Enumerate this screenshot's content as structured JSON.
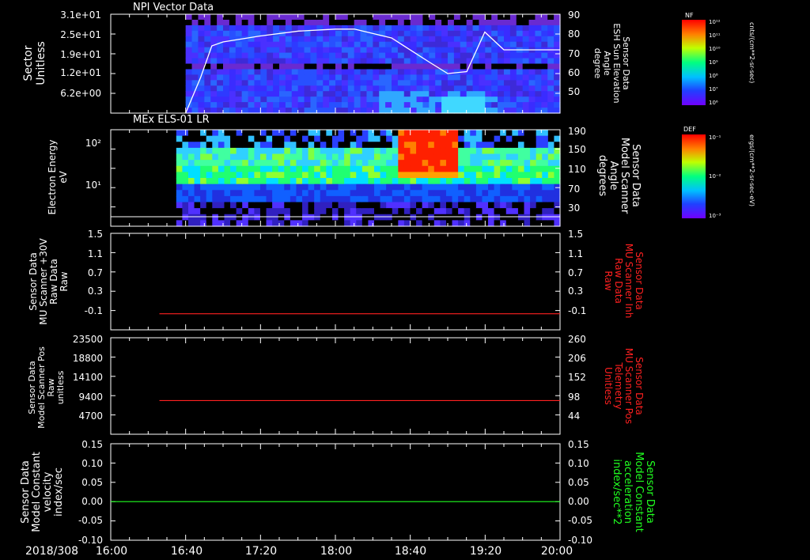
{
  "colors": {
    "background": "#000000",
    "axis": "#ffffff",
    "red_trace": "#ff2020",
    "green_trace": "#20ff20",
    "white_trace": "#ffffff"
  },
  "time_axis": {
    "start_label": "2018/308",
    "ticks": [
      "16:00",
      "16:40",
      "17:20",
      "18:00",
      "18:40",
      "19:20",
      "20:00"
    ],
    "start_hour": 16.0,
    "end_hour": 20.0,
    "data_start_hour": 16.6667
  },
  "chart_data": [
    {
      "type": "heatmap",
      "title": "NPI Vector Data",
      "ylabel_left": [
        "Sector",
        "Unitless"
      ],
      "yticks_left": [
        "3.1e+01",
        "2.5e+01",
        "1.9e+01",
        "1.2e+01",
        "6.2e+00"
      ],
      "ylabel_right": [
        "Sensor Data",
        "ESH Sun Elevation",
        "Angle",
        "degree"
      ],
      "yticks_right": [
        "90",
        "80",
        "70",
        "60",
        "50"
      ],
      "ylim_right": [
        40,
        90
      ],
      "line_series": {
        "name": "ESH Sun Elevation Angle",
        "x": [
          16.6667,
          16.8,
          16.9,
          17.0,
          17.33,
          17.67,
          18.0,
          18.17,
          18.5,
          18.83,
          19.0,
          19.17,
          19.33,
          19.5,
          20.0
        ],
        "y": [
          40,
          58,
          74,
          76,
          79,
          81.5,
          82.5,
          82.5,
          78,
          66,
          60,
          61,
          81,
          72,
          72
        ]
      },
      "colorbar": {
        "label": "NF",
        "units": "cnts/(cm**2-sr-sec)",
        "ticks": [
          "10¹²",
          "10¹¹",
          "10¹⁰",
          "10⁹",
          "10⁸",
          "10⁷",
          "10⁶"
        ]
      }
    },
    {
      "type": "heatmap",
      "title": "MEx ELS-01 LR",
      "ylabel_left": [
        "Electron Energy",
        "eV"
      ],
      "yticks_left": [
        "10²",
        "10¹"
      ],
      "ylabel_right": [
        "Sensor Data",
        "Model Scanner",
        "Angle",
        "degrees"
      ],
      "yticks_right": [
        "190",
        "150",
        "110",
        "70",
        "30"
      ],
      "ylim_right": [
        0,
        190
      ],
      "colorbar": {
        "label": "DEF",
        "units": "ergs/(cm**2-sr-sec-eV)",
        "ticks": [
          "10⁻¹",
          "10⁻²",
          "10⁻³"
        ]
      }
    },
    {
      "type": "line",
      "ylabel_left": [
        "Sensor Data",
        "MU Scanner +30V",
        "Raw Data",
        "Raw"
      ],
      "yticks_left": [
        "1.5",
        "1.1",
        "0.7",
        "0.3",
        "-0.1"
      ],
      "ylim_left": [
        -0.3,
        1.5
      ],
      "ylabel_right": [
        "Sensor Data",
        "MU Scanner Inh",
        "Raw Data",
        "Raw"
      ],
      "yticks_right": [
        "1.5",
        "1.1",
        "0.7",
        "0.3",
        "-0.1"
      ],
      "series": [
        {
          "x": [
            16.4333,
            20.0
          ],
          "y": [
            0.0,
            0.0
          ]
        }
      ]
    },
    {
      "type": "line",
      "ylabel_left": [
        "Sensor Data",
        "Model Scanner Pos",
        "Raw",
        "unitless"
      ],
      "yticks_left": [
        "23500",
        "18800",
        "14100",
        "9400",
        "4700"
      ],
      "ylim_left": [
        0,
        23500
      ],
      "ylabel_right": [
        "Sensor Data",
        "MU Scanner Pos",
        "Telemetry",
        "Unitless"
      ],
      "yticks_right": [
        "260",
        "206",
        "152",
        "98",
        "44"
      ],
      "series": [
        {
          "x": [
            16.4333,
            20.0
          ],
          "y": [
            8200,
            8200
          ]
        }
      ]
    },
    {
      "type": "line",
      "ylabel_left": [
        "Sensor Data",
        "Model Constant",
        "velocity",
        "index/sec"
      ],
      "yticks_left": [
        "0.15",
        "0.10",
        "0.05",
        "0.00",
        "-0.05",
        "-0.10"
      ],
      "ylim_left": [
        -0.1,
        0.15
      ],
      "ylabel_right": [
        "Sensor Data",
        "Model Constant",
        "acceleration",
        "index/sec**2"
      ],
      "yticks_right": [
        "0.15",
        "0.10",
        "0.05",
        "0.00",
        "-0.05",
        "-0.10"
      ],
      "series": [
        {
          "x": [
            16.0,
            20.0
          ],
          "y": [
            0.0,
            0.0
          ]
        }
      ]
    }
  ]
}
